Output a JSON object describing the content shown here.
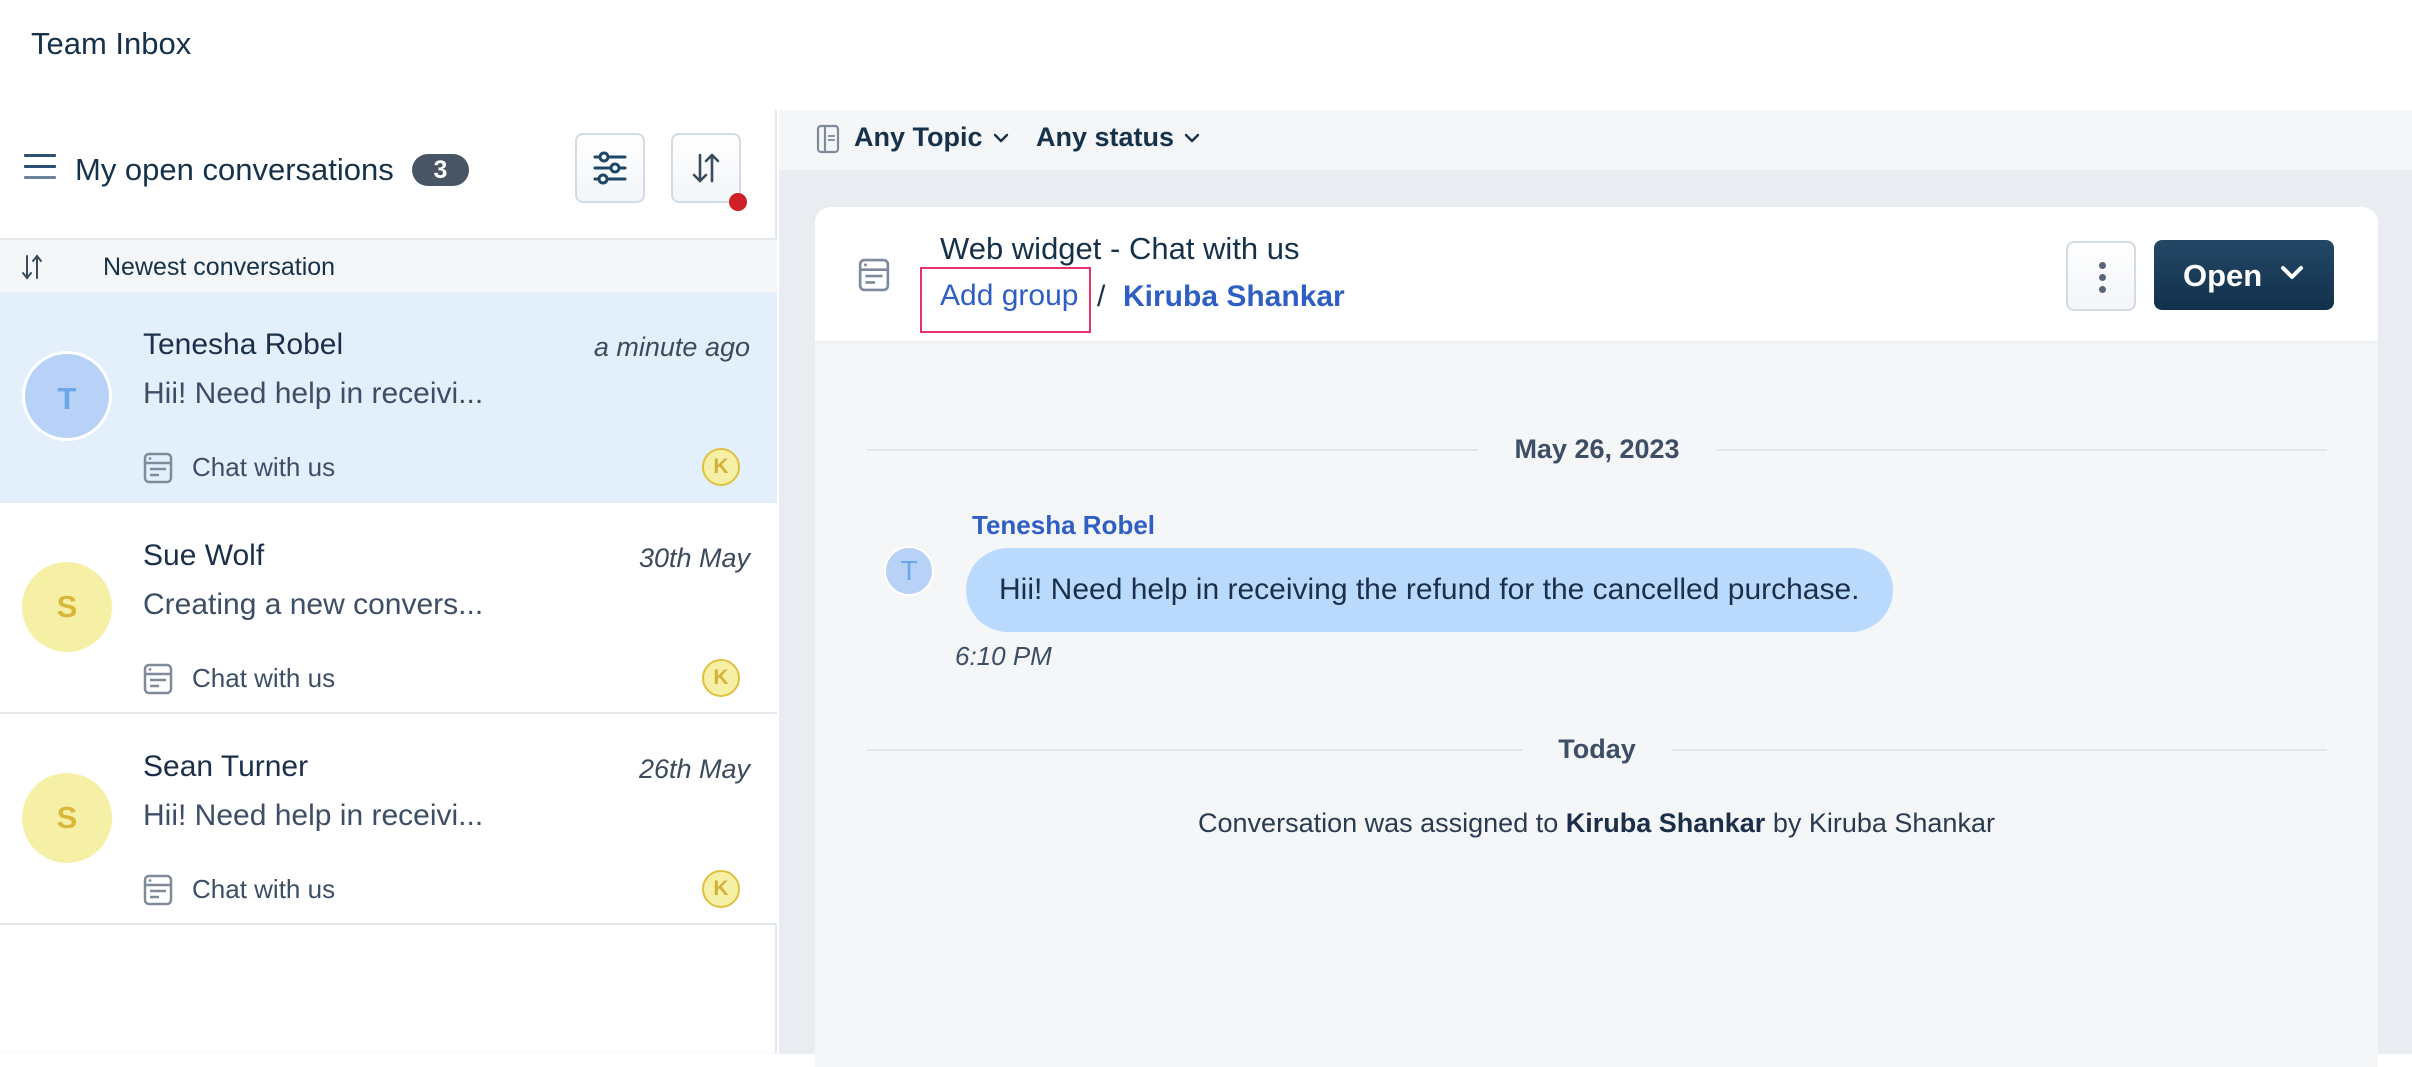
{
  "app": {
    "title": "Team Inbox"
  },
  "left_panel": {
    "title": "My open conversations",
    "count": "3",
    "filter_icon": "sliders-icon",
    "sort_icon": "sort-arrows-icon",
    "sort_has_indicator": true,
    "sort_label": "Newest conversation",
    "conversations": [
      {
        "initial": "T",
        "name": "Tenesha Robel",
        "time": "a minute ago",
        "preview": "Hii! Need help in receivi...",
        "channel": "Chat with us",
        "agent_initial": "K",
        "selected": true,
        "avatar_color": "#b7d2f6"
      },
      {
        "initial": "S",
        "name": "Sue Wolf",
        "time": "30th May",
        "preview": "Creating a new convers...",
        "channel": "Chat with us",
        "agent_initial": "K",
        "selected": false,
        "avatar_color": "#f6f0a7"
      },
      {
        "initial": "S",
        "name": "Sean Turner",
        "time": "26th May",
        "preview": "Hii! Need help in receivi...",
        "channel": "Chat with us",
        "agent_initial": "K",
        "selected": false,
        "avatar_color": "#f6f0a7"
      }
    ]
  },
  "filters": {
    "topic": "Any Topic",
    "status": "Any status"
  },
  "conversation": {
    "title": "Web widget - Chat with us",
    "add_group": "Add group",
    "separator": "/",
    "assignee": "Kiruba Shankar",
    "status_button": "Open",
    "date_divider": "May 26, 2023",
    "message": {
      "sender": "Tenesha Robel",
      "avatar_initial": "T",
      "text": "Hii! Need help in receiving the refund for the cancelled purchase.",
      "time": "6:10 PM"
    },
    "today_divider": "Today",
    "system_message": {
      "prefix": "Conversation was assigned to",
      "assignee": "Kiruba Shankar",
      "suffix": "by Kiruba Shankar"
    }
  },
  "colors": {
    "accent_blue": "#2f5fc4",
    "primary_dark": "#16324a",
    "selected_row": "#e3f0fc",
    "highlight_border": "#e8336a",
    "notification_dot": "#cf2027"
  }
}
